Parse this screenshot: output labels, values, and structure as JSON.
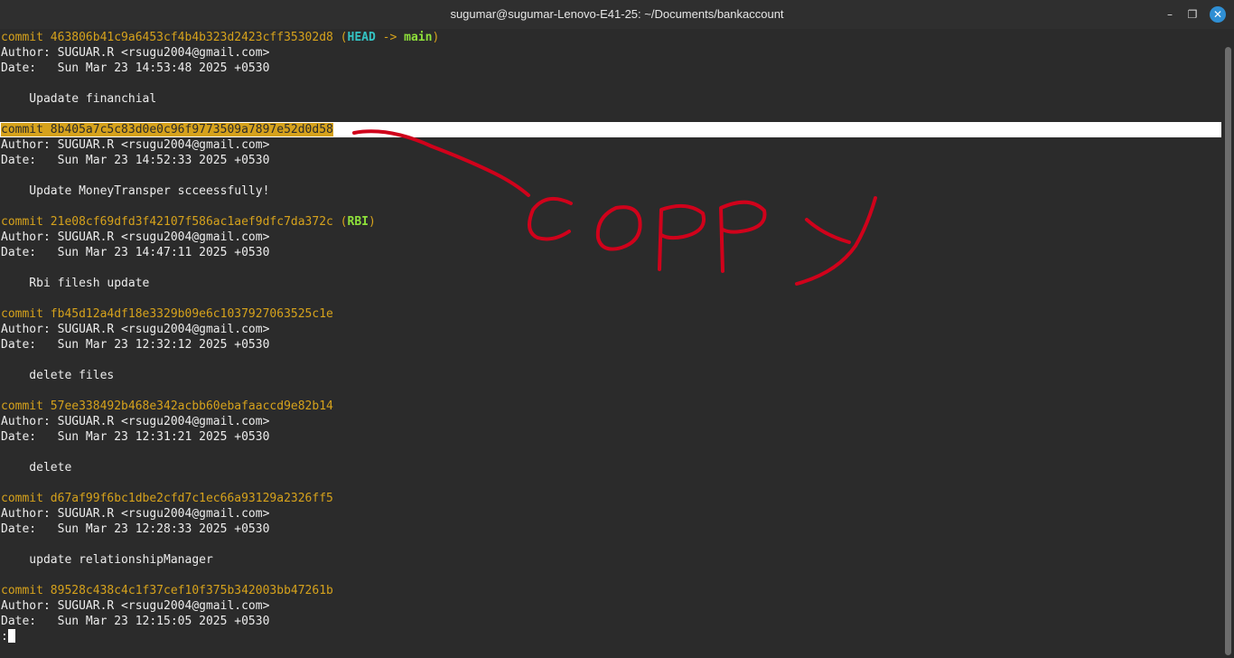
{
  "window": {
    "title": "sugumar@sugumar-Lenovo-E41-25: ~/Documents/bankaccount",
    "controls": {
      "minimize": "–",
      "maximize": "❐",
      "close": "✕"
    }
  },
  "log": {
    "commits": [
      {
        "hash_line": "commit 463806b41c9a6453cf4b4b323d2423cff35302d8",
        "author": "Author: SUGUAR.R <rsugu2004@gmail.com>",
        "date": "Date:   Sun Mar 23 14:53:48 2025 +0530",
        "message": "    Upadate financhial"
      },
      {
        "hash_line": "commit 8b405a7c5c83d0e0c96f9773509a7897e52d0d58",
        "author": "Author: SUGUAR.R <rsugu2004@gmail.com>",
        "date": "Date:   Sun Mar 23 14:52:33 2025 +0530",
        "message": "    Update MoneyTransper scceessfully!"
      },
      {
        "hash_line": "commit 21e08cf69dfd3f42107f586ac1aef9dfc7da372c",
        "author": "Author: SUGUAR.R <rsugu2004@gmail.com>",
        "date": "Date:   Sun Mar 23 14:47:11 2025 +0530",
        "message": "    Rbi filesh update"
      },
      {
        "hash_line": "commit fb45d12a4df18e3329b09e6c1037927063525c1e",
        "author": "Author: SUGUAR.R <rsugu2004@gmail.com>",
        "date": "Date:   Sun Mar 23 12:32:12 2025 +0530",
        "message": "    delete files"
      },
      {
        "hash_line": "commit 57ee338492b468e342acbb60ebafaaccd9e82b14",
        "author": "Author: SUGUAR.R <rsugu2004@gmail.com>",
        "date": "Date:   Sun Mar 23 12:31:21 2025 +0530",
        "message": "    delete"
      },
      {
        "hash_line": "commit d67af99f6bc1dbe2cfd7c1ec66a93129a2326ff5",
        "author": "Author: SUGUAR.R <rsugu2004@gmail.com>",
        "date": "Date:   Sun Mar 23 12:28:33 2025 +0530",
        "message": "    update relationshipManager"
      },
      {
        "hash_line": "commit 89528c438c4c1f37cef10f375b342003bb47261b",
        "author": "Author: SUGUAR.R <rsugu2004@gmail.com>",
        "date": "Date:   Sun Mar 23 12:15:05 2025 +0530"
      }
    ],
    "decorations": {
      "open1": " (",
      "head": "HEAD",
      "arrow": " -> ",
      "main": "main",
      "close1": ")",
      "open2": " (",
      "rbi": "RBI",
      "close2": ")"
    },
    "prompt": ":"
  },
  "annotation": {
    "text": "COPPY",
    "color": "#d0021b"
  },
  "colors": {
    "background": "#2b2b2b",
    "commit_hash": "#d6a21c",
    "head_ref": "#34c3c3",
    "branch_ref": "#8ee03a",
    "selection": "#ffffff"
  }
}
